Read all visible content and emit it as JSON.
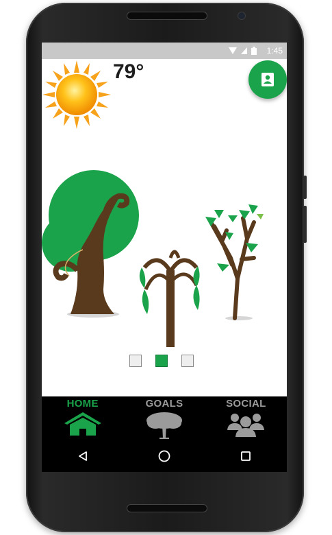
{
  "statusbar": {
    "time": "1:45"
  },
  "weather": {
    "temperature": "79°",
    "icon": "sun-icon"
  },
  "fab": {
    "icon": "contact-card-icon"
  },
  "carousel": {
    "illustration": "trees-illustration",
    "pages": 3,
    "active_page": 2
  },
  "tabs": [
    {
      "label": "HOME",
      "icon": "home-icon",
      "active": true
    },
    {
      "label": "GOALS",
      "icon": "tree-icon",
      "active": false
    },
    {
      "label": "SOCIAL",
      "icon": "group-icon",
      "active": false
    }
  ],
  "colors": {
    "accent": "#1aa34a",
    "inactive_tab": "#9b9b9b",
    "trunk": "#5a3a1c"
  },
  "navbar": {
    "back_icon": "back-triangle-icon",
    "home_icon": "home-circle-icon",
    "recents_icon": "recents-square-icon"
  }
}
